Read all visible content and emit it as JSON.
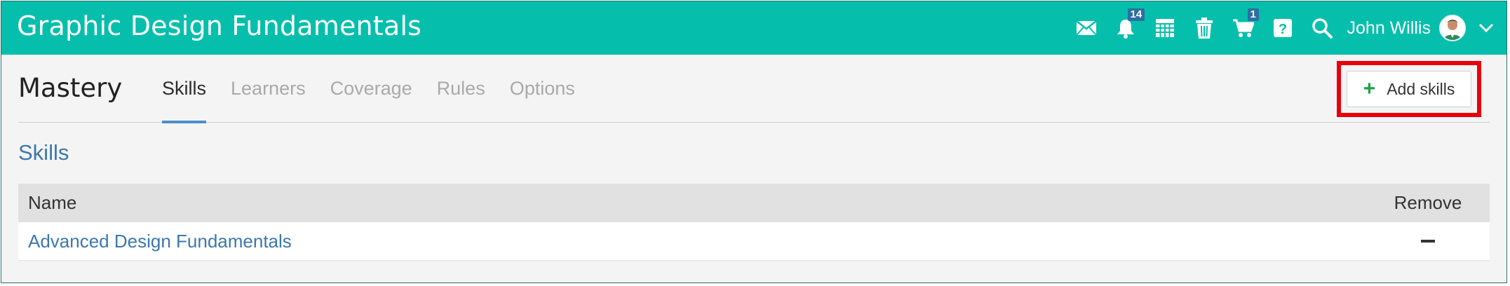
{
  "app": {
    "title": "Graphic Design Fundamentals",
    "accent_color": "#05bfac"
  },
  "topbar": {
    "icons": [
      "mail-icon",
      "notifications-bell-icon",
      "calendar-icon",
      "trash-icon",
      "cart-icon",
      "help-icon",
      "search-icon"
    ],
    "notifications_count": "14",
    "cart_count": "1",
    "user_name": "John Willis",
    "menu_icon": "chevron-down-icon"
  },
  "page": {
    "title": "Mastery",
    "tabs": [
      {
        "label": "Skills",
        "active": true
      },
      {
        "label": "Learners",
        "active": false
      },
      {
        "label": "Coverage",
        "active": false
      },
      {
        "label": "Rules",
        "active": false
      },
      {
        "label": "Options",
        "active": false
      }
    ],
    "add_button_label": "Add skills",
    "highlight_color": "#e8000b"
  },
  "skills": {
    "section_title": "Skills",
    "columns": {
      "name": "Name",
      "remove": "Remove"
    },
    "rows": [
      {
        "name": "Advanced Design Fundamentals"
      }
    ]
  }
}
